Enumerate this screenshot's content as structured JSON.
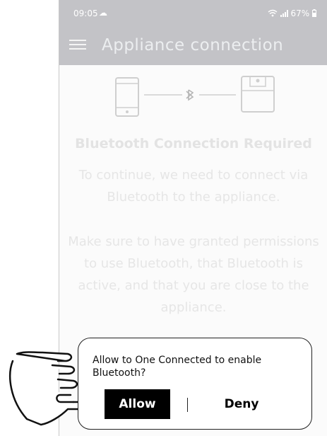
{
  "status_bar": {
    "time": "09:05",
    "battery": "67%"
  },
  "app_bar": {
    "title": "Appliance connection"
  },
  "content": {
    "title": "Bluetooth Connection Required",
    "paragraph1": "To continue, we need to connect via Bluetooth to the appliance.",
    "paragraph2": "Make sure to have granted permissions to use Bluetooth, that Bluetooth is active, and that you are close to the appliance."
  },
  "dialog": {
    "message": "Allow to One Connected to enable Bluetooth?",
    "allow_label": "Allow",
    "deny_label": "Deny"
  },
  "colors": {
    "appbar_bg": "#c3c3c7",
    "dialog_border": "#222222",
    "allow_bg": "#000000"
  },
  "icons": [
    "menu-icon",
    "phone-icon",
    "bluetooth-icon",
    "appliance-icon",
    "cloud-icon",
    "wifi-icon",
    "signal-icon",
    "battery-icon",
    "hand-pointer-icon"
  ]
}
